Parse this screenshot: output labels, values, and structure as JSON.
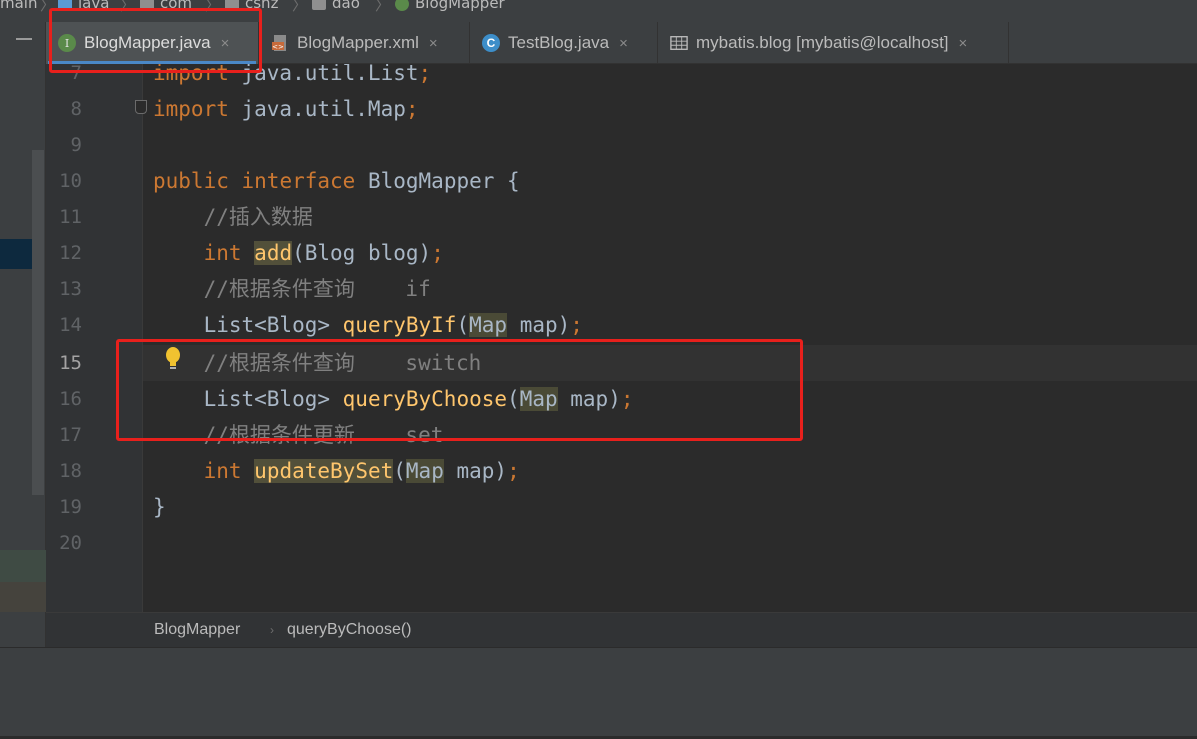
{
  "breadcrumb": {
    "items": [
      {
        "label": "main",
        "icon": "none"
      },
      {
        "label": "java",
        "icon": "folder-icon"
      },
      {
        "label": "com",
        "icon": "package-icon"
      },
      {
        "label": "cshz",
        "icon": "package-icon"
      },
      {
        "label": "dao",
        "icon": "package-icon"
      },
      {
        "label": "BlogMapper",
        "icon": "interface-icon"
      }
    ]
  },
  "tabs": [
    {
      "label": "BlogMapper.java",
      "icon": "interface-icon",
      "active": true
    },
    {
      "label": "BlogMapper.xml",
      "icon": "xml-file-icon",
      "active": false
    },
    {
      "label": "TestBlog.java",
      "icon": "class-icon",
      "active": false
    },
    {
      "label": "mybatis.blog [mybatis@localhost]",
      "icon": "table-icon",
      "active": false
    }
  ],
  "tab_close_glyph": "×",
  "gutter": {
    "line_numbers": [
      "7",
      "8",
      "9",
      "10",
      "11",
      "12",
      "13",
      "14",
      "15",
      "16",
      "17",
      "18",
      "19",
      "20"
    ],
    "current_line": "15"
  },
  "code": {
    "l7_kw": "import",
    "l7_rest": " java.util.List",
    "l7_semi": ";",
    "l8_kw": "import",
    "l8_rest": " java.util.Map",
    "l8_semi": ";",
    "l10_kw1": "public",
    "l10_kw2": "interface",
    "l10_rest": " BlogMapper {",
    "l11_comment": "    //插入数据",
    "l12_kw": "int",
    "l12_fn": "add",
    "l12_rest": "(Blog blog)",
    "l12_semi": ";",
    "l13_comment": "    //根据条件查询    if",
    "l14_type": "    List<Blog> ",
    "l14_fn": "queryByIf",
    "l14_paren": "(",
    "l14_arg": "Map",
    "l14_rest": " map)",
    "l14_semi": ";",
    "l15_comment": "    //根据条件查询    switch",
    "l16_type": "    List<Blog> ",
    "l16_fn": "queryByChoose",
    "l16_paren": "(",
    "l16_arg": "Map",
    "l16_rest": " map)",
    "l16_semi": ";",
    "l17_comment": "    //根据条件更新    set",
    "l18_kw": "int",
    "l18_fn": "updateBySet",
    "l18_paren": "(",
    "l18_arg": "Map",
    "l18_rest": " map)",
    "l18_semi": ";",
    "l19": "}"
  },
  "code_breadcrumb": {
    "class": "BlogMapper",
    "separator": "›",
    "method": "queryByChoose()"
  },
  "colors": {
    "keyword": "#cc7832",
    "comment": "#808080",
    "function": "#ffc66d",
    "default_text": "#a9b7c6",
    "annotation_box": "#e8201c",
    "active_tab_underline": "#4a88c7"
  }
}
